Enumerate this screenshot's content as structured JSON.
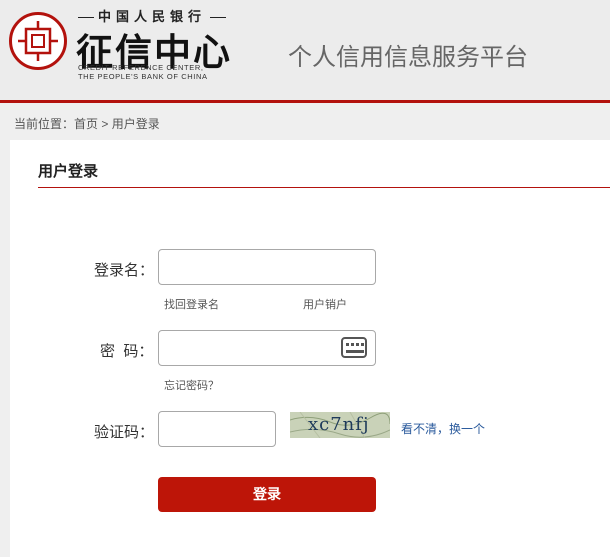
{
  "header": {
    "org_cn": "中国人民银行",
    "brand": "征信中心",
    "en_line1": "CREDIT REFERENCE CENTER,",
    "en_line2": "THE PEOPLE'S BANK OF CHINA",
    "platform_title": "个人信用信息服务平台",
    "accent_color": "#b3120d"
  },
  "breadcrumb": {
    "prefix": "当前位置：",
    "home": "首页",
    "separator": " > ",
    "current": "用户登录"
  },
  "login": {
    "title": "用户登录",
    "username_label": "登录名：",
    "username_value": "",
    "find_username_link": "找回登录名",
    "cancel_account_link": "用户销户",
    "password_label": "密  码：",
    "password_value": "",
    "keyboard_icon": "keyboard-icon",
    "forgot_password_link": "忘记密码？",
    "captcha_label": "验证码：",
    "captcha_value": "",
    "captcha_text": "xc7nfj",
    "refresh_captcha_link": "看不清，换一个",
    "submit_label": "登录",
    "button_color": "#bd1508"
  }
}
